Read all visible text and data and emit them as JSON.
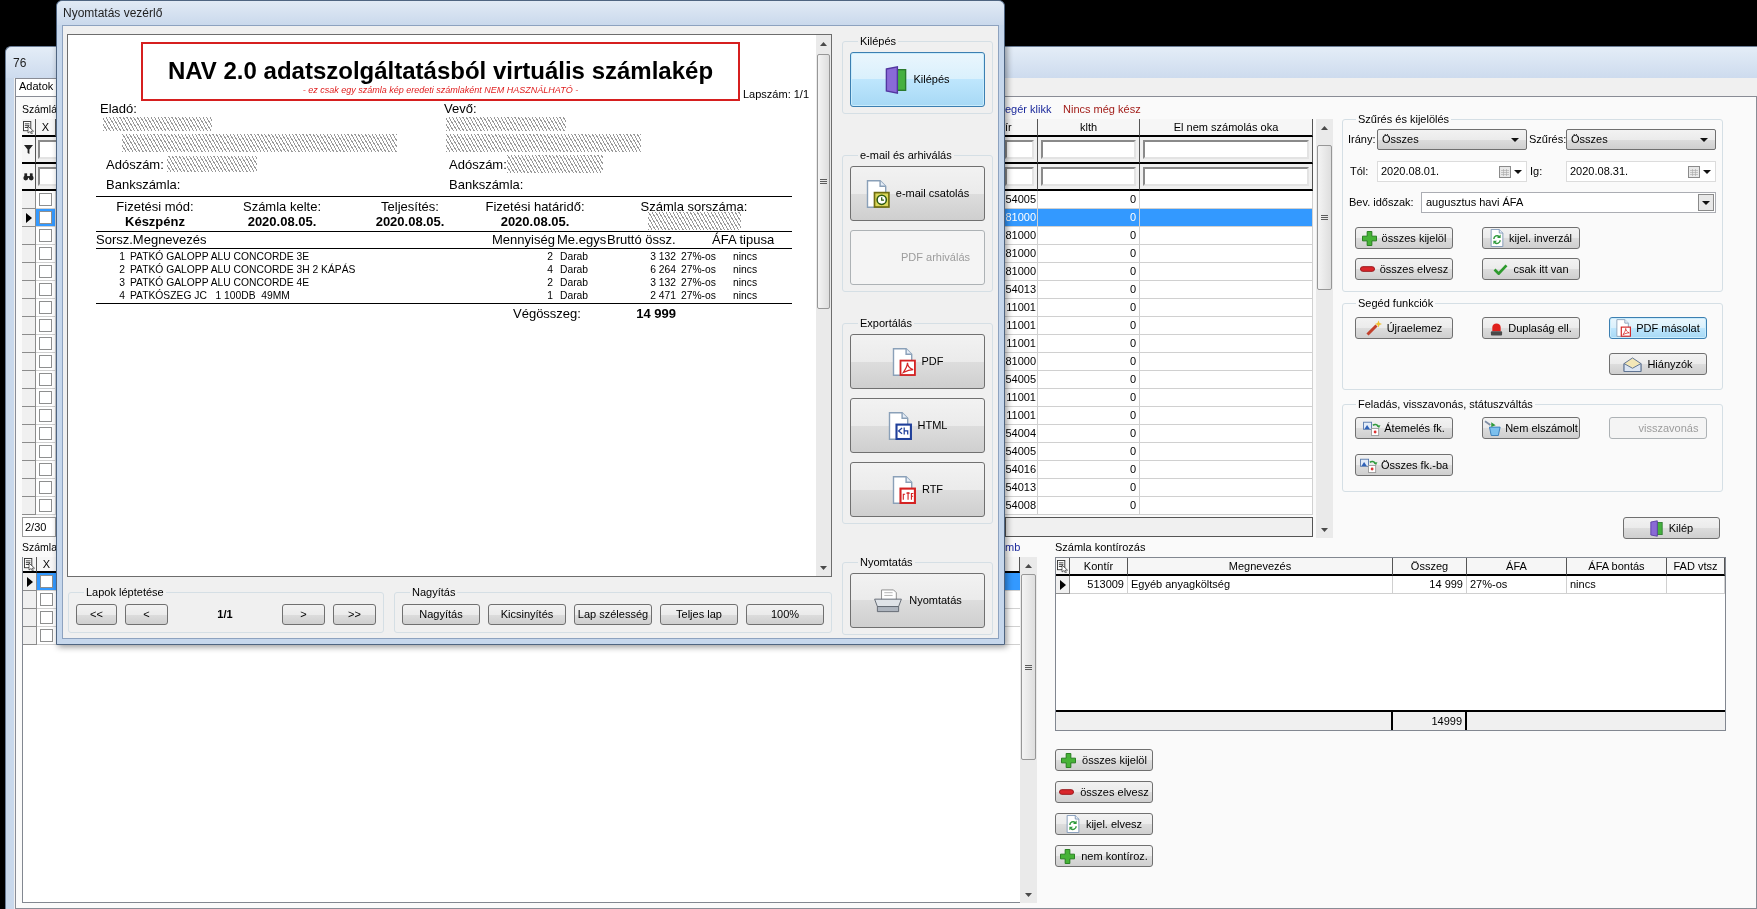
{
  "main_window": {
    "title": "76",
    "tabs": [
      {
        "label": "Adatok",
        "selected": true
      }
    ],
    "invoice_grid": {
      "caption": "Számlá",
      "legend": [
        {
          "text": "egér klikk",
          "color": "#1c2a9c"
        },
        {
          "text": "Nincs még kész",
          "color": "#a3201c"
        }
      ],
      "check_header": "X",
      "columns": [
        "ír",
        "klth",
        "El nem számolás oka"
      ],
      "rows": [
        {
          "current": false,
          "selected": false,
          "checked": false,
          "cells": [
            "54005",
            "0"
          ]
        },
        {
          "current": true,
          "selected": true,
          "checked": false,
          "cells": [
            "81000",
            "0"
          ]
        },
        {
          "current": false,
          "selected": false,
          "checked": false,
          "cells": [
            "81000",
            "0"
          ]
        },
        {
          "current": false,
          "selected": false,
          "checked": false,
          "cells": [
            "81000",
            "0"
          ]
        },
        {
          "current": false,
          "selected": false,
          "checked": false,
          "cells": [
            "81000",
            "0"
          ]
        },
        {
          "current": false,
          "selected": false,
          "checked": false,
          "cells": [
            "54013",
            "0"
          ]
        },
        {
          "current": false,
          "selected": false,
          "checked": false,
          "cells": [
            "11001",
            "0"
          ]
        },
        {
          "current": false,
          "selected": false,
          "checked": false,
          "cells": [
            "11001",
            "0"
          ]
        },
        {
          "current": false,
          "selected": false,
          "checked": false,
          "cells": [
            "11001",
            "0"
          ]
        },
        {
          "current": false,
          "selected": false,
          "checked": false,
          "cells": [
            "81000",
            "0"
          ]
        },
        {
          "current": false,
          "selected": false,
          "checked": false,
          "cells": [
            "54005",
            "0"
          ]
        },
        {
          "current": false,
          "selected": false,
          "checked": false,
          "cells": [
            "11001",
            "0"
          ]
        },
        {
          "current": false,
          "selected": false,
          "checked": false,
          "cells": [
            "11001",
            "0"
          ]
        },
        {
          "current": false,
          "selected": false,
          "checked": false,
          "cells": [
            "54004",
            "0"
          ]
        },
        {
          "current": false,
          "selected": false,
          "checked": false,
          "cells": [
            "54005",
            "0"
          ]
        },
        {
          "current": false,
          "selected": false,
          "checked": false,
          "cells": [
            "54016",
            "0"
          ]
        },
        {
          "current": false,
          "selected": false,
          "checked": false,
          "cells": [
            "54013",
            "0"
          ]
        },
        {
          "current": false,
          "selected": false,
          "checked": false,
          "cells": [
            "54008",
            "0"
          ]
        }
      ],
      "record_count": "2/30"
    },
    "filter_group": {
      "title": "Szűrés és kijelölés",
      "direction": {
        "label": "Irány:",
        "value": "Összes"
      },
      "filter": {
        "label": "Szűrés:",
        "value": "Összes"
      },
      "date_from": {
        "label": "Tól:",
        "value": "2020.08.01."
      },
      "date_to": {
        "label": "Ig:",
        "value": "2020.08.31."
      },
      "period": {
        "label": "Bev. időszak:",
        "value": "augusztus havi ÁFA"
      },
      "buttons": [
        {
          "label": "összes kijelöl",
          "kind": "plus"
        },
        {
          "label": "kijel. inverzál",
          "kind": "refresh"
        },
        {
          "label": "összes elvesz",
          "kind": "minus"
        },
        {
          "label": "csak itt van",
          "kind": "check"
        }
      ]
    },
    "helper_group": {
      "title": "Segéd funkciók",
      "buttons": [
        {
          "label": "Újraelemez",
          "kind": "wand",
          "focused": false
        },
        {
          "label": "Duplaság ell.",
          "kind": "alarm",
          "focused": false
        },
        {
          "label": "PDF másolat",
          "kind": "pdf",
          "focused": true
        },
        {
          "label": "Hiányzók",
          "kind": "envelope",
          "focused": false
        }
      ]
    },
    "posting_group": {
      "title": "Feladás, visszavonás, státuszváltás",
      "buttons": [
        {
          "label": "Átemelés fk.",
          "kind": "transfer",
          "disabled": false
        },
        {
          "label": "Nem elszámolt",
          "kind": "bucket",
          "disabled": false
        },
        {
          "label": "visszavonás",
          "kind": "text",
          "disabled": true
        },
        {
          "label": "Összes fk.-ba",
          "kind": "transfer",
          "disabled": false
        }
      ]
    },
    "exit_button": {
      "label": "Kilép",
      "kind": "door"
    },
    "lower_grid": {
      "caption": "Számla",
      "caption_tail": "mb",
      "check_header": "X",
      "rows": [
        {
          "current": true,
          "selected": true,
          "checked": false
        },
        {
          "current": false,
          "selected": false,
          "checked": false
        },
        {
          "current": false,
          "selected": false,
          "checked": false
        },
        {
          "current": false,
          "selected": false,
          "checked": false
        }
      ]
    },
    "account_assignment": {
      "caption": "Számla kontírozás",
      "columns": [
        "Kontír",
        "Megnevezés",
        "Összeg",
        "ÁFA",
        "ÁFA bontás",
        "FAD vtsz"
      ],
      "rows": [
        {
          "current": true,
          "selected": false,
          "cells": [
            "513009",
            "Egyéb anyagköltség",
            "14 999",
            "27%-os",
            "nincs"
          ]
        }
      ],
      "total": "14999",
      "buttons": [
        {
          "label": "összes kijelöl",
          "kind": "plus"
        },
        {
          "label": "összes elvesz",
          "kind": "minus"
        },
        {
          "label": "kijel. elvesz",
          "kind": "refresh"
        },
        {
          "label": "nem kontíroz.",
          "kind": "plus"
        }
      ]
    }
  },
  "print_dialog": {
    "title": "Nyomtatás vezérlő",
    "invoice": {
      "heading": "NAV 2.0 adatszolgáltatásból virtuális számlakép",
      "disclaimer": "- ez csak egy számla kép eredeti számlaként NEM HASZNÁLHATÓ -",
      "page_number": "Lapszám: 1/1",
      "seller": {
        "label": "Eladó:",
        "tax_number_label": "Adószám:",
        "bank_account_label": "Bankszámla:"
      },
      "buyer": {
        "label": "Vevő:",
        "tax_number_label": "Adószám:",
        "bank_account_label": "Bankszámla:"
      },
      "payment": [
        {
          "label": "Fizetési mód:",
          "value": "Készpénz",
          "redacted": false
        },
        {
          "label": "Számla kelte:",
          "value": "2020.08.05.",
          "redacted": false
        },
        {
          "label": "Teljesítés:",
          "value": "2020.08.05.",
          "redacted": false
        },
        {
          "label": "Fizetési határidő:",
          "value": "2020.08.05.",
          "redacted": false
        },
        {
          "label": "Számla sorszáma:",
          "redacted": true
        }
      ],
      "item_columns": [
        "Sorsz.Megnevezés",
        "Mennyiség",
        "Me.egys",
        "Bruttó össz.",
        "ÁFA tipusa"
      ],
      "items": [
        {
          "no": "1",
          "name": "PATKÓ GALOPP ALU CONCORDE 3E",
          "quantity": "2",
          "unit": "Darab",
          "gross": "3 132",
          "vat": "27%-os",
          "vat_type": "nincs"
        },
        {
          "no": "2",
          "name": "PATKÓ GALOPP ALU CONCORDE 3H 2 KÁPÁS",
          "quantity": "4",
          "unit": "Darab",
          "gross": "6 264",
          "vat": "27%-os",
          "vat_type": "nincs"
        },
        {
          "no": "3",
          "name": "PATKÓ GALOPP ALU CONCORDE 4E",
          "quantity": "2",
          "unit": "Darab",
          "gross": "3 132",
          "vat": "27%-os",
          "vat_type": "nincs"
        },
        {
          "no": "4",
          "name": "PATKÓSZEG JC   1 100DB  49MM",
          "quantity": "1",
          "unit": "Darab",
          "gross": "2 471",
          "vat": "27%-os",
          "vat_type": "nincs"
        }
      ],
      "total_label": "Végösszeg:",
      "total": "14 999"
    },
    "side_groups": [
      {
        "title": "Kilépés",
        "buttons": [
          {
            "label": "Kilépés",
            "kind": "door",
            "focused": true,
            "disabled": false
          }
        ]
      },
      {
        "title": "e-mail és arhiválás",
        "buttons": [
          {
            "label": "e-mail csatolás",
            "kind": "email",
            "focused": false,
            "disabled": false
          },
          {
            "label": "PDF arhiválás",
            "kind": "text",
            "focused": false,
            "disabled": true
          }
        ]
      },
      {
        "title": "Exportálás",
        "buttons": [
          {
            "label": "PDF",
            "kind": "pdf",
            "focused": false,
            "disabled": false
          },
          {
            "label": "HTML",
            "kind": "html",
            "focused": false,
            "disabled": false
          },
          {
            "label": "RTF",
            "kind": "rtf",
            "focused": false,
            "disabled": false
          }
        ]
      },
      {
        "title": "Nyomtatás",
        "buttons": [
          {
            "label": "Nyomtatás",
            "kind": "printer",
            "focused": false,
            "disabled": false
          }
        ]
      }
    ],
    "paging": {
      "title": "Lapok léptetése",
      "first": "<<",
      "previous": "<",
      "page": "1/1",
      "next": ">",
      "last": ">>"
    },
    "zoom": {
      "title": "Nagyítás",
      "buttons": [
        "Nagyítás",
        "Kicsinyítés",
        "Lap szélesség",
        "Teljes lap",
        "100%"
      ]
    }
  }
}
